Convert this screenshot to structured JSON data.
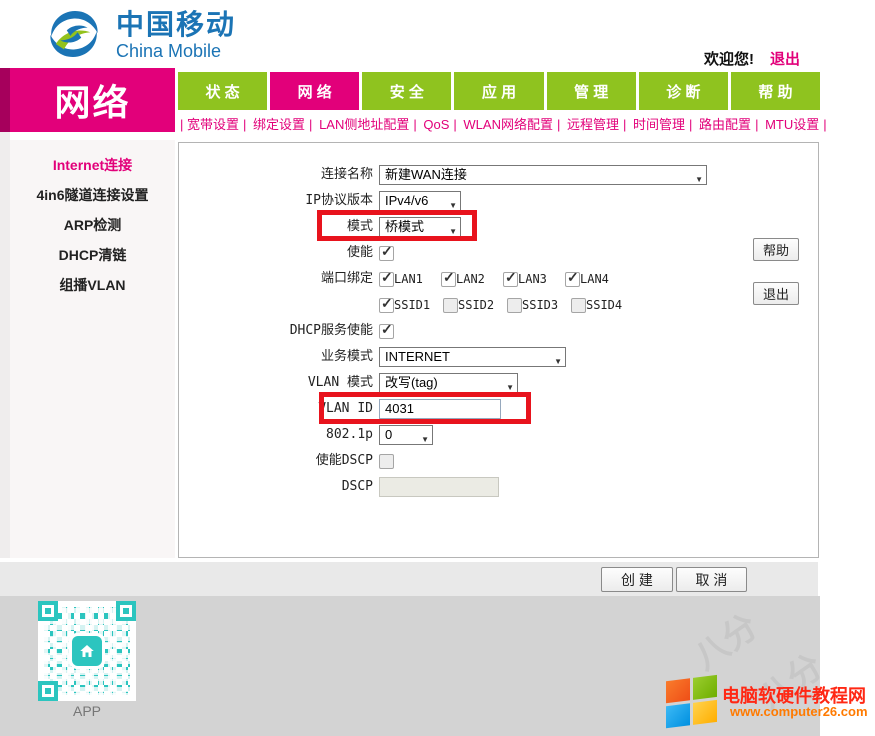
{
  "colors": {
    "accent_magenta": "#E2007A",
    "tab_green": "#8FC31F",
    "highlight_red": "#E8131D",
    "qr_teal": "#2CC5BF",
    "logo_blue": "#1B74B5"
  },
  "brand": {
    "cn": "中国移动",
    "en": "China Mobile"
  },
  "header": {
    "welcome": "欢迎您!",
    "logout": "退出"
  },
  "nav": {
    "section_title": "网络",
    "tabs": [
      {
        "label": "状 态",
        "active": false
      },
      {
        "label": "网 络",
        "active": true
      },
      {
        "label": "安 全",
        "active": false
      },
      {
        "label": "应 用",
        "active": false
      },
      {
        "label": "管 理",
        "active": false
      },
      {
        "label": "诊 断",
        "active": false
      },
      {
        "label": "帮 助",
        "active": false
      }
    ],
    "subnav": [
      "宽带设置",
      "绑定设置",
      "LAN侧地址配置",
      "QoS",
      "WLAN网络配置",
      "远程管理",
      "时间管理",
      "路由配置",
      "MTU设置"
    ]
  },
  "sidebar": {
    "items": [
      {
        "label": "Internet连接",
        "active": true
      },
      {
        "label": "4in6隧道连接设置",
        "active": false
      },
      {
        "label": "ARP检测",
        "active": false
      },
      {
        "label": "DHCP清链",
        "active": false
      },
      {
        "label": "组播VLAN",
        "active": false
      }
    ]
  },
  "form": {
    "connection_name": {
      "label": "连接名称",
      "value": "新建WAN连接"
    },
    "ip_version": {
      "label": "IP协议版本",
      "value": "IPv4/v6"
    },
    "mode": {
      "label": "模式",
      "value": "桥模式"
    },
    "enable": {
      "label": "使能",
      "checked": true
    },
    "port_binding": {
      "label": "端口绑定",
      "lan": [
        {
          "label": "LAN1",
          "checked": true
        },
        {
          "label": "LAN2",
          "checked": true
        },
        {
          "label": "LAN3",
          "checked": true
        },
        {
          "label": "LAN4",
          "checked": true
        }
      ],
      "ssid": [
        {
          "label": "SSID1",
          "checked": true
        },
        {
          "label": "SSID2",
          "checked": false
        },
        {
          "label": "SSID3",
          "checked": false
        },
        {
          "label": "SSID4",
          "checked": false
        }
      ]
    },
    "dhcp_enable": {
      "label": "DHCP服务使能",
      "checked": true
    },
    "service_mode": {
      "label": "业务模式",
      "value": "INTERNET"
    },
    "vlan_mode": {
      "label": "VLAN 模式",
      "value": "改写(tag)"
    },
    "vlan_id": {
      "label": "VLAN ID",
      "value": "4031"
    },
    "dot1p": {
      "label": "802.1p",
      "value": "0"
    },
    "dscp_enable": {
      "label": "使能DSCP",
      "checked": false
    },
    "dscp": {
      "label": "DSCP",
      "value": ""
    }
  },
  "panel_buttons": {
    "help": "帮助",
    "exit": "退出"
  },
  "actions": {
    "create": "创 建",
    "cancel": "取 消"
  },
  "footer": {
    "app_label": "APP",
    "site_name": "电脑软硬件教程网",
    "site_url": "www.computer26.com",
    "watermark": "八分"
  }
}
